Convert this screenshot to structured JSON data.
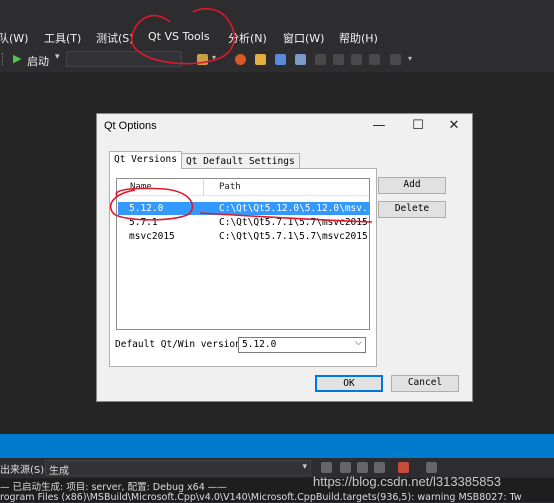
{
  "menubar": {
    "items": [
      "队(W)",
      "工具(T)",
      "测试(S)",
      "Qt VS Tools",
      "分析(N)",
      "窗口(W)",
      "帮助(H)"
    ]
  },
  "toolbar": {
    "start_label": "启动",
    "start_arrow": "▾"
  },
  "dialog": {
    "title": "Qt Options",
    "minimize": "—",
    "maximize": "☐",
    "close": "✕",
    "tabs": [
      "Qt Versions",
      "Qt Default Settings"
    ],
    "table": {
      "headers": [
        "Name",
        "Path"
      ],
      "rows": [
        {
          "name": "5.12.0",
          "path": "C:\\Qt\\Qt5.12.0\\5.12.0\\msv...",
          "selected": true
        },
        {
          "name": "5.7.1",
          "path": "C:\\Qt\\Qt5.7.1\\5.7\\msvc2015",
          "selected": false
        },
        {
          "name": "msvc2015",
          "path": "C:\\Qt\\Qt5.7.1\\5.7\\msvc2015",
          "selected": false
        }
      ]
    },
    "add_label": "Add",
    "delete_label": "Delete",
    "default_version_label": "Default Qt/Win version:",
    "default_version_value": "5.12.0",
    "ok_label": "OK",
    "cancel_label": "Cancel"
  },
  "output": {
    "source_label": "出来源(S):",
    "source_value": "生成",
    "line1": "— 已启动生成: 项目: server, 配置: Debug x64 ——",
    "line2": "rogram Files (x86)\\MSBuild\\Microsoft.Cpp\\v4.0\\V140\\Microsoft.CppBuild.targets(936,5): warning MSB8027: Tw"
  },
  "watermark": "https://blog.csdn.net/l313385853",
  "colors": {
    "ide_bg": "#2d2d30",
    "accent_blue": "#007acc",
    "selection": "#3399ff",
    "annotation_red": "#e0182b"
  }
}
